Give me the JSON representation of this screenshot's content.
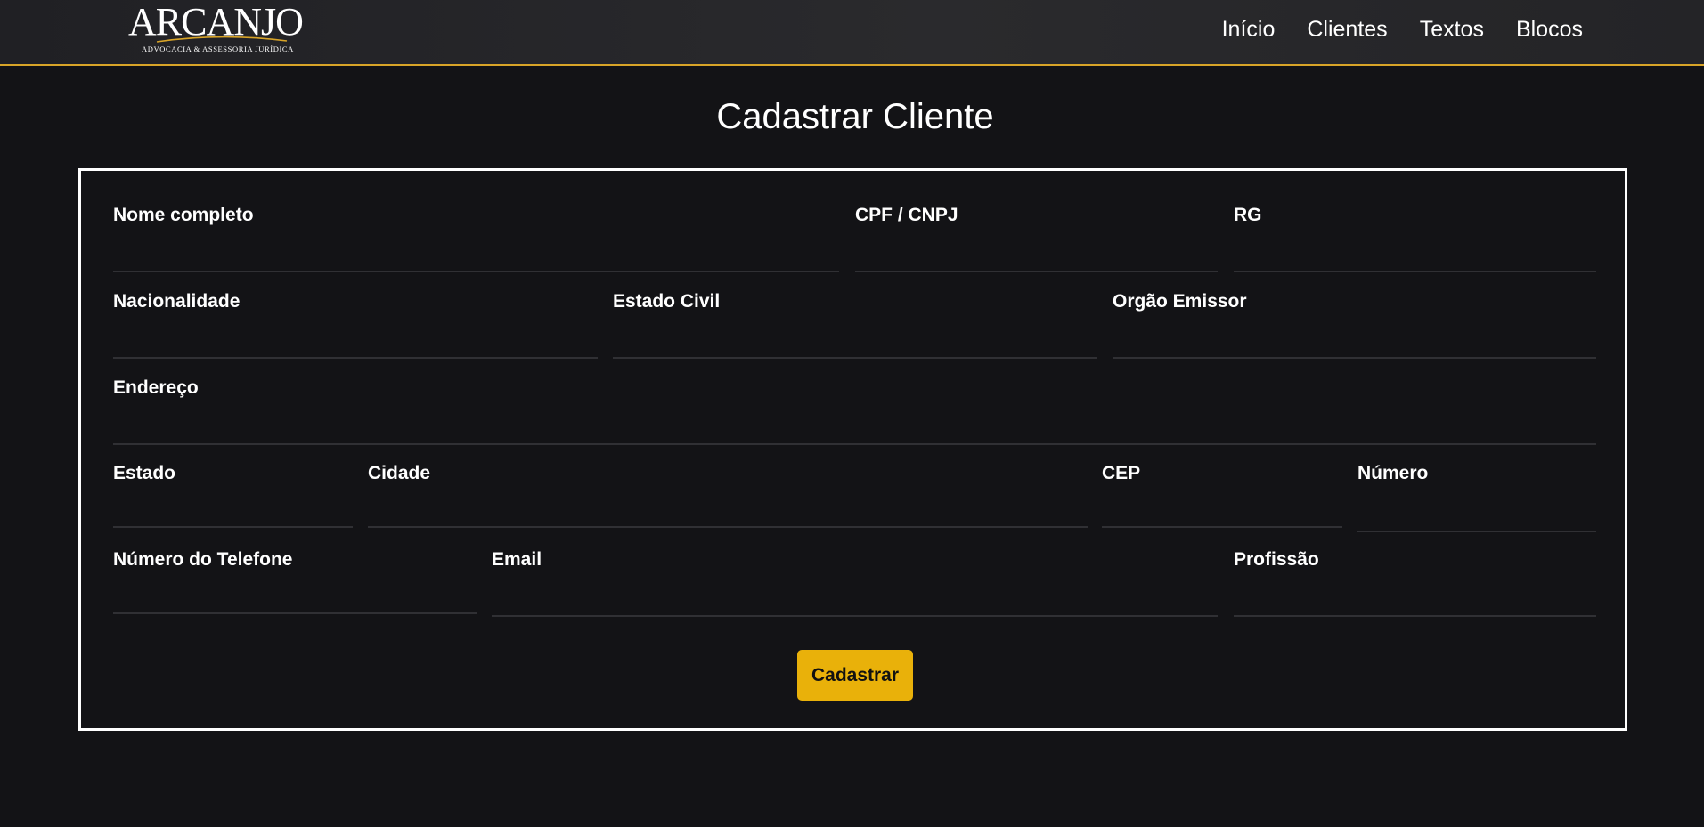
{
  "brand": {
    "name": "ARCANJO",
    "tagline": "Advocacia & Assessoria Jurídica",
    "accent_color": "#d8a428"
  },
  "nav": {
    "items": [
      {
        "label": "Início"
      },
      {
        "label": "Clientes"
      },
      {
        "label": "Textos"
      },
      {
        "label": "Blocos"
      }
    ]
  },
  "page": {
    "title": "Cadastrar Cliente"
  },
  "form": {
    "fields": {
      "nome_completo": {
        "label": "Nome completo",
        "value": ""
      },
      "cpf_cnpj": {
        "label": "CPF / CNPJ",
        "value": ""
      },
      "rg": {
        "label": "RG",
        "value": ""
      },
      "nacionalidade": {
        "label": "Nacionalidade",
        "value": ""
      },
      "estado_civil": {
        "label": "Estado Civil",
        "value": ""
      },
      "orgao_emissor": {
        "label": "Orgão Emissor",
        "value": ""
      },
      "endereco": {
        "label": "Endereço",
        "value": ""
      },
      "estado": {
        "label": "Estado",
        "value": ""
      },
      "cidade": {
        "label": "Cidade",
        "value": ""
      },
      "cep": {
        "label": "CEP",
        "value": ""
      },
      "numero": {
        "label": "Número",
        "value": ""
      },
      "telefone": {
        "label": "Número do Telefone",
        "value": ""
      },
      "email": {
        "label": "Email",
        "value": ""
      },
      "profissao": {
        "label": "Profissão",
        "value": ""
      }
    },
    "submit_label": "Cadastrar",
    "submit_color": "#e9b10a"
  }
}
